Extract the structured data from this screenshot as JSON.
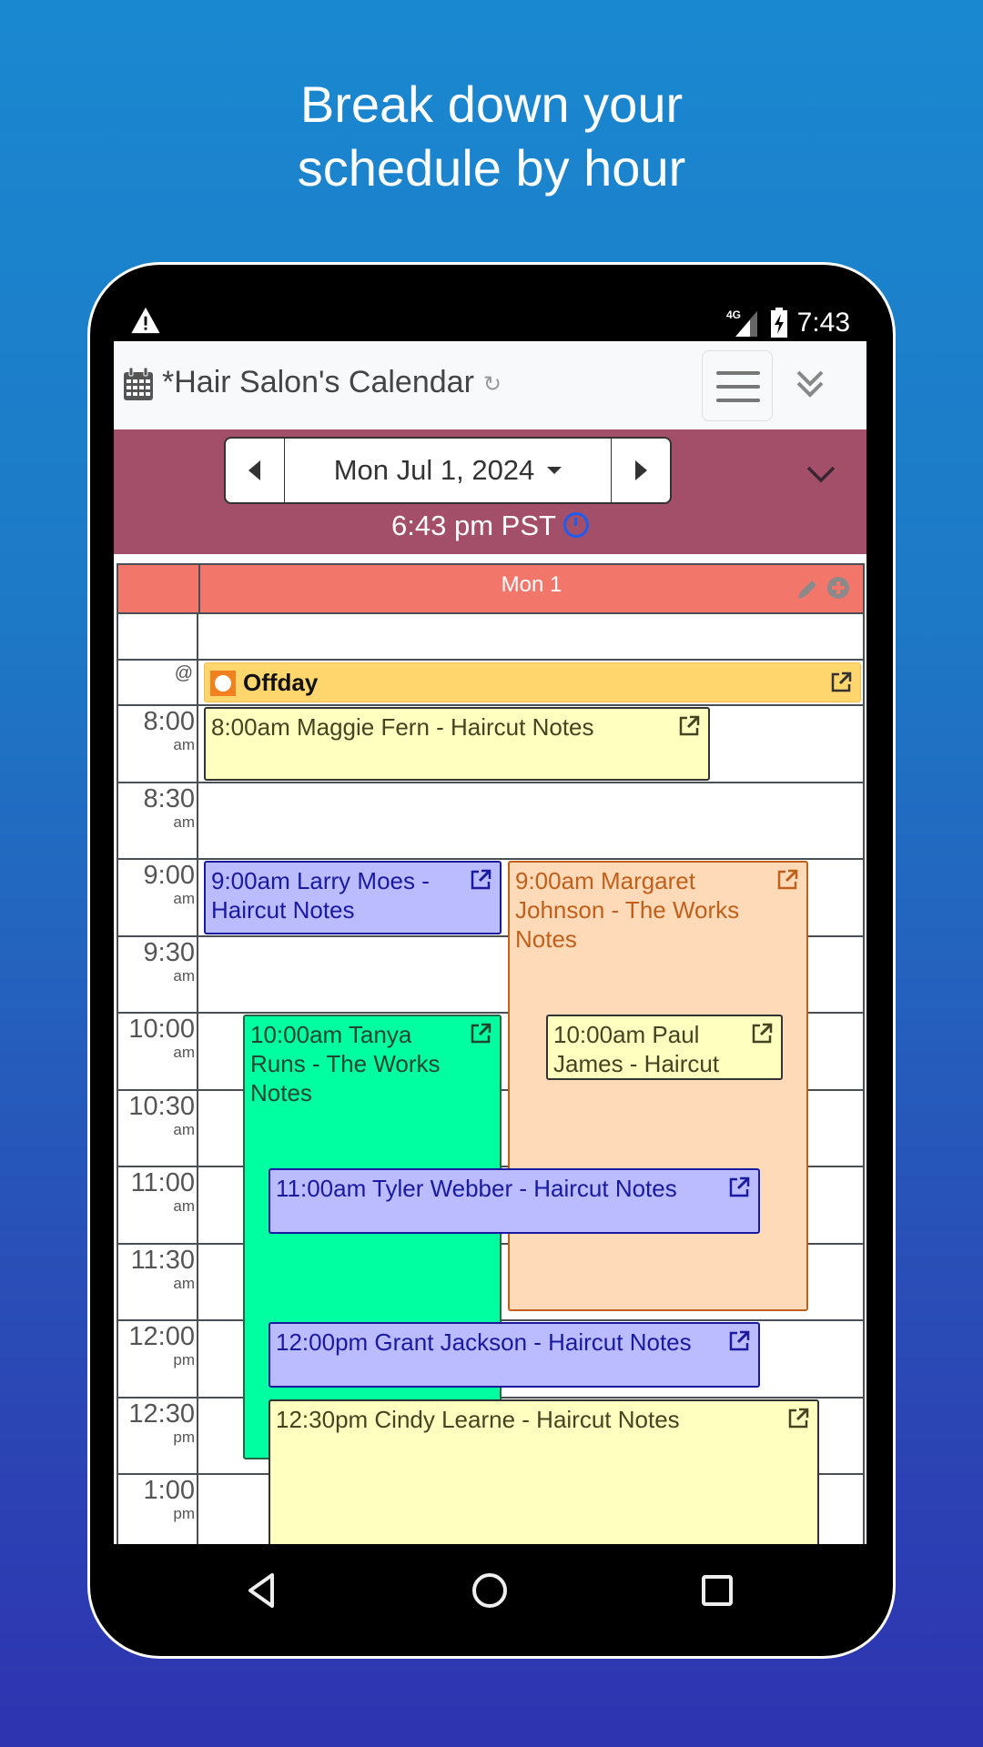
{
  "headline": {
    "line1": "Break down your",
    "line2": "schedule by hour"
  },
  "status_bar": {
    "network": "4G",
    "time": "7:43",
    "icons": [
      "warning-icon",
      "signal-icon",
      "battery-charging-icon"
    ]
  },
  "title_bar": {
    "title": "*Hair Salon's Calendar",
    "icons": [
      "calendar-icon",
      "sync-icon",
      "menu-icon",
      "double-chevron-down-icon"
    ]
  },
  "date_nav": {
    "date": "Mon Jul 1, 2024",
    "current_time": "6:43 pm PST"
  },
  "grid": {
    "day_header": "Mon 1",
    "all_day_marker": "@",
    "all_day_event": {
      "label": "Offday",
      "color": "#ffd66e"
    },
    "time_slots": [
      {
        "time": "8:00",
        "ampm": "am"
      },
      {
        "time": "8:30",
        "ampm": "am"
      },
      {
        "time": "9:00",
        "ampm": "am"
      },
      {
        "time": "9:30",
        "ampm": "am"
      },
      {
        "time": "10:00",
        "ampm": "am"
      },
      {
        "time": "10:30",
        "ampm": "am"
      },
      {
        "time": "11:00",
        "ampm": "am"
      },
      {
        "time": "11:30",
        "ampm": "am"
      },
      {
        "time": "12:00",
        "ampm": "pm"
      },
      {
        "time": "12:30",
        "ampm": "pm"
      },
      {
        "time": "1:00",
        "ampm": "pm"
      }
    ],
    "events": [
      {
        "text": "8:00am Maggie Fern - Haircut  Notes",
        "start": 8.0,
        "end": 8.5,
        "lane": "full-narrow",
        "bg": "#ffffc0",
        "border": "#333333",
        "fg": "#444422"
      },
      {
        "text": "9:00am Larry Moes - Haircut  Notes",
        "start": 9.0,
        "end": 9.5,
        "lane": "left",
        "bg": "#bbbbff",
        "border": "#1a1aa0",
        "fg": "#1a1aa0"
      },
      {
        "text": "9:00am Margaret Johnson - The Works Notes",
        "start": 9.0,
        "end": 11.95,
        "lane": "right",
        "bg": "#ffdab9",
        "border": "#c0601a",
        "fg": "#c0601a"
      },
      {
        "text": "10:00am Tanya Runs - The Works Notes",
        "start": 10.0,
        "end": 12.92,
        "lane": "left-indent",
        "bg": "#00ffa0",
        "border": "#226644",
        "fg": "#224433"
      },
      {
        "text": "10:00am Paul James - Haircut",
        "start": 10.0,
        "end": 10.45,
        "lane": "right-inner",
        "bg": "#ffffc0",
        "border": "#333333",
        "fg": "#444422"
      },
      {
        "text": "11:00am Tyler Webber - Haircut  Notes",
        "start": 11.0,
        "end": 11.45,
        "lane": "wide",
        "bg": "#bbbbff",
        "border": "#1a1aa0",
        "fg": "#1a1aa0"
      },
      {
        "text": "12:00pm Grant Jackson - Haircut Notes",
        "start": 12.0,
        "end": 12.45,
        "lane": "wide",
        "bg": "#bbbbff",
        "border": "#1a1aa0",
        "fg": "#1a1aa0"
      },
      {
        "text": "12:30pm Cindy Learne - Haircut  Notes",
        "start": 12.5,
        "end": 13.5,
        "lane": "wide-full",
        "bg": "#ffffc0",
        "border": "#333333",
        "fg": "#444422"
      }
    ]
  },
  "colors": {
    "nav_band": "#a44f6a",
    "day_header": "#f3766b",
    "clock_accent": "#1d5cf0"
  },
  "system_nav": {
    "buttons": [
      "back-button",
      "home-button",
      "recents-button"
    ]
  }
}
